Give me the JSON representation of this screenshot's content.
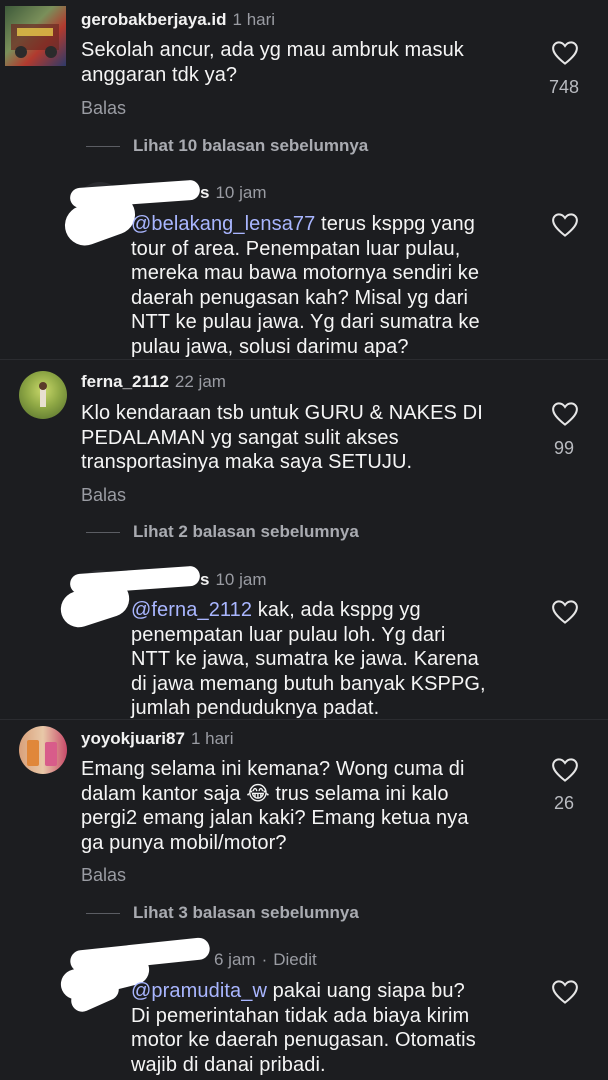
{
  "comments": [
    {
      "username": "gerobakberjaya.id",
      "time": "1 hari",
      "text": "Sekolah ancur, ada yg mau ambruk masuk anggaran tdk ya?",
      "lines": [
        "Sekolah ancur, ada yg mau ambruk masuk",
        "anggaran tdk ya?"
      ],
      "likes": "748",
      "reply_label": "Balas",
      "view_replies": "Lihat 10 balasan sebelumnya",
      "reply": {
        "username_visible": "s",
        "time": "10 jam",
        "mention": "@belakang_lensa77",
        "lines_after_mention": " terus ksppg yang",
        "lines": [
          "tour of area. Penempatan luar pulau,",
          "mereka mau bawa motornya sendiri ke",
          "daerah penugasan kah? Misal yg dari",
          "NTT ke pulau jawa. Yg dari sumatra ke",
          "pulau jawa, solusi darimu apa?"
        ]
      }
    },
    {
      "username": "ferna_2112",
      "time": "22 jam",
      "lines": [
        "Klo kendaraan tsb untuk GURU & NAKES DI",
        "PEDALAMAN yg sangat sulit akses",
        "transportasinya maka saya SETUJU."
      ],
      "likes": "99",
      "reply_label": "Balas",
      "view_replies": "Lihat 2 balasan sebelumnya",
      "reply": {
        "username_visible": "s",
        "time": "10 jam",
        "mention": "@ferna_2112",
        "lines_after_mention": " kak, ada ksppg yg",
        "lines": [
          "penempatan luar pulau loh. Yg dari",
          "NTT ke jawa, sumatra ke jawa. Karena",
          "di jawa memang butuh banyak KSPPG,",
          "jumlah penduduknya padat."
        ]
      }
    },
    {
      "username": "yoyokjuari87",
      "time": "1 hari",
      "line1_before_emoji": "Emang selama ini kemana? Wong cuma di",
      "line2_before_emoji": "dalam kantor saja",
      "emoji": "😂",
      "line2_after_emoji": " trus selama ini kalo",
      "lines": [
        "pergi2 emang jalan kaki? Emang ketua nya",
        "ga punya mobil/motor?"
      ],
      "likes": "26",
      "reply_label": "Balas",
      "view_replies": "Lihat 3 balasan sebelumnya",
      "reply": {
        "time": "6 jam",
        "edited": "Diedit",
        "mention": "@pramudita_w",
        "lines_after_mention": " pakai uang siapa bu?",
        "lines": [
          "Di pemerintahan tidak ada biaya kirim",
          "motor ke daerah penugasan. Otomatis",
          "wajib di danai pribadi."
        ]
      }
    }
  ],
  "icons": {
    "like": "heart-outline-icon"
  },
  "colors": {
    "background": "#1c1d20",
    "mention": "#a9b6ff",
    "muted": "#9a9ca3"
  }
}
